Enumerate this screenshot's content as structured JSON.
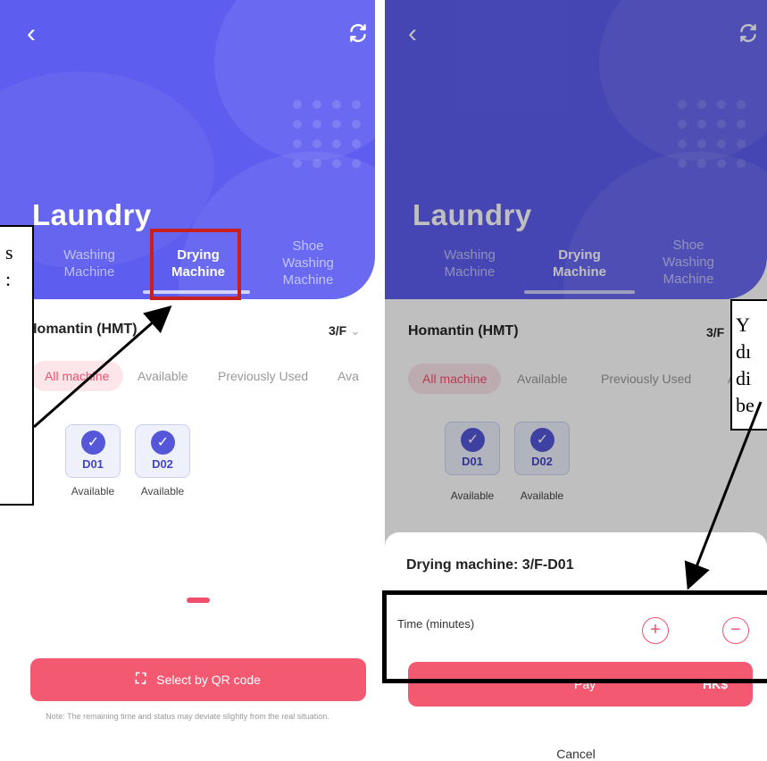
{
  "left_screen": {
    "title": "Laundry",
    "tabs": [
      {
        "line1": "Washing",
        "line2": "Machine",
        "line3": ""
      },
      {
        "line1": "Drying",
        "line2": "Machine",
        "line3": ""
      },
      {
        "line1": "Shoe",
        "line2": "Washing",
        "line3": "Machine"
      }
    ],
    "active_tab": "Drying Machine",
    "location": "Homantin (HMT)",
    "floor": "3/F",
    "filters": [
      "All machine",
      "Available",
      "Previously Used",
      "Ava"
    ],
    "machines": [
      {
        "id": "D01",
        "status": "Available"
      },
      {
        "id": "D02",
        "status": "Available"
      }
    ],
    "qr_button": "Select by QR code",
    "note": "Note: The remaining time and status may deviate slightly from the real situation."
  },
  "right_screen": {
    "title": "Laundry",
    "tabs": [
      {
        "line1": "Washing",
        "line2": "Machine",
        "line3": ""
      },
      {
        "line1": "Drying",
        "line2": "Machine",
        "line3": ""
      },
      {
        "line1": "Shoe",
        "line2": "Washing",
        "line3": "Machine"
      }
    ],
    "location": "Homantin (HMT)",
    "floor": "3/F",
    "filters": [
      "All machine",
      "Available",
      "Previously Used",
      "A"
    ],
    "machines": [
      {
        "id": "D01",
        "status": "Available"
      },
      {
        "id": "D02",
        "status": "Available"
      }
    ],
    "sheet": {
      "title": "Drying machine: 3/F-D01",
      "time_label": "Time (minutes)",
      "plus": "+",
      "minus": "−",
      "pay_label": "Pay",
      "pay_currency": "HK$",
      "cancel": "Cancel"
    }
  },
  "annotations": {
    "left_callout_fragments": [
      "s",
      "",
      ":"
    ],
    "right_callout_fragments": [
      "Y",
      "dı",
      "di",
      "be"
    ]
  },
  "colors": {
    "hero": "#5d5df0",
    "accent": "#f35a72",
    "machine_blue": "#5557d8",
    "highlight_red": "#c81f1f"
  },
  "icons": [
    "back-icon",
    "refresh-icon",
    "check-icon",
    "qr-scan-icon",
    "plus-icon",
    "minus-icon"
  ]
}
